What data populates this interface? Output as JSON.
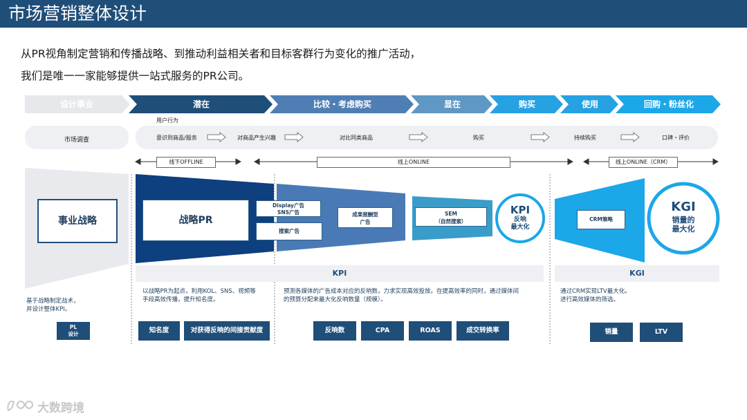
{
  "page": {
    "title": "市场营销整体设计"
  },
  "intro": {
    "line1": "从PR视角制定营销和传播战略、到推动利益相关者和目标客群行为变化的推广活动，",
    "line2": "我们是唯一一家能够提供一站式服务的PR公司。"
  },
  "stages": [
    "设计事业",
    "潜在",
    "比较・考虑购买",
    "显在",
    "购买",
    "使用",
    "回购・粉丝化"
  ],
  "user_behavior": {
    "label": "用户行为",
    "left_cell": "市场调查",
    "steps": [
      "意识到商品/服务",
      "对商品产生兴趣",
      "对比同类商品",
      "购买",
      "持续购买",
      "口碑・评价"
    ]
  },
  "channels": [
    "线下OFFLINE",
    "线上ONLINE",
    "线上ONLINE（CRM）"
  ],
  "funnel": {
    "strategy": "事业战略",
    "pr": "战略PR",
    "display_ad": "Display广告\nSNS广告",
    "search_ad": "搜索广告",
    "result_ad": "成果报酬型\n广告",
    "sem": "SEM\n（自然搜索）",
    "kpi_circle_title": "KPI",
    "kpi_circle_sub": "反响\n最大化",
    "crm": "CRM策略",
    "kgi_circle_title": "KGI",
    "kgi_circle_sub": "销量的\n最大化"
  },
  "kpi_bar": "KPI",
  "kgi_bar": "KGI",
  "descriptions": {
    "strategy": "基于战略制定战术，\n并设计整体KPI。",
    "pr": "以战略PR为起点，利用KOL、SNS、视频等\n手段高效传播，提升知名度。",
    "ads": "预测各媒体的广告成本对应的反响数，力求实现高效投放。在提高效率的同时，通过媒体间\n的预算分配来最大化反响数量（规模）。",
    "crm": "通过CRM实现LTV最大化。\n进行高效媒体的筛选。"
  },
  "metrics": {
    "pl": "PL\n设计",
    "awareness": "知名度",
    "indirect": "对获得反响的间接贡献度",
    "response": "反响数",
    "cpa": "CPA",
    "roas": "ROAS",
    "conversion": "成交转换率",
    "sales": "销量",
    "ltv": "LTV"
  },
  "watermark": {
    "text": "大数跨境"
  },
  "colors": {
    "navy": "#1f4e79",
    "dark_navy": "#0e3f7e",
    "mid_blue": "#2f6ea8",
    "steel_blue": "#4a7ab5",
    "teal": "#3a9cc8",
    "light_blue": "#1ba7e8",
    "grey_chevron": "#e6e8ec",
    "pill_bg": "#eef0f3"
  }
}
